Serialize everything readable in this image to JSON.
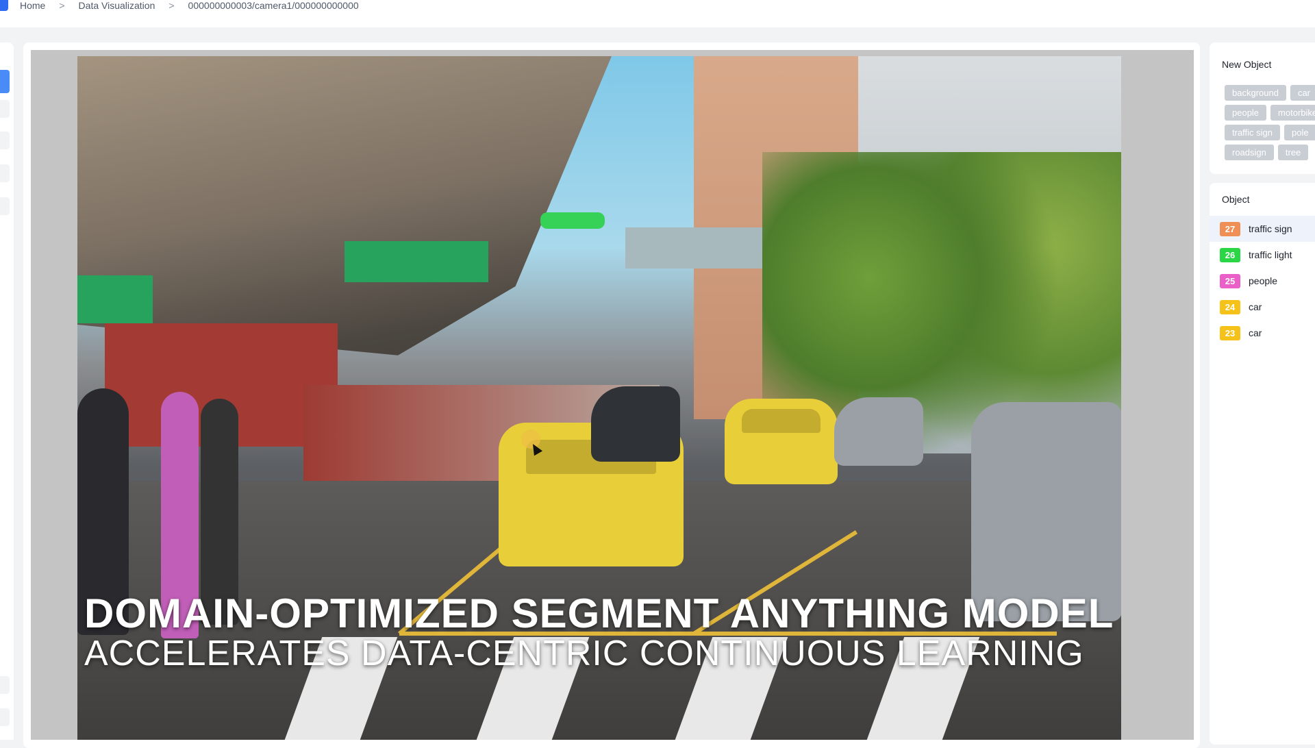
{
  "breadcrumb": {
    "items": [
      "Home",
      "Data Visualization",
      "000000000003/camera1/000000000000"
    ],
    "separator": ">"
  },
  "video": {
    "title_line1": "DOMAIN-OPTIMIZED SEGMENT ANYTHING MODEL",
    "title_line2": "ACCELERATES DATA-CENTRIC CONTINUOUS LEARNING"
  },
  "new_object": {
    "title": "New Object",
    "tags": [
      "background",
      "car",
      "people",
      "motorbike",
      "traffic sign",
      "pole",
      "roadsign",
      "tree"
    ]
  },
  "objects": {
    "title": "Object",
    "items": [
      {
        "id": "27",
        "label": "traffic sign",
        "color": "#f08f55",
        "selected": true
      },
      {
        "id": "26",
        "label": "traffic light",
        "color": "#2bd646",
        "selected": false
      },
      {
        "id": "25",
        "label": "people",
        "color": "#ea5fc8",
        "selected": false
      },
      {
        "id": "24",
        "label": "car",
        "color": "#f5c21a",
        "selected": false
      },
      {
        "id": "23",
        "label": "car",
        "color": "#f5c21a",
        "selected": false
      }
    ]
  },
  "colors": {
    "accent": "#2f6bf0",
    "car_mask": "#e8cf3a",
    "people_mask": "#c15fb8",
    "traffic_light_mask": "#36d157"
  }
}
